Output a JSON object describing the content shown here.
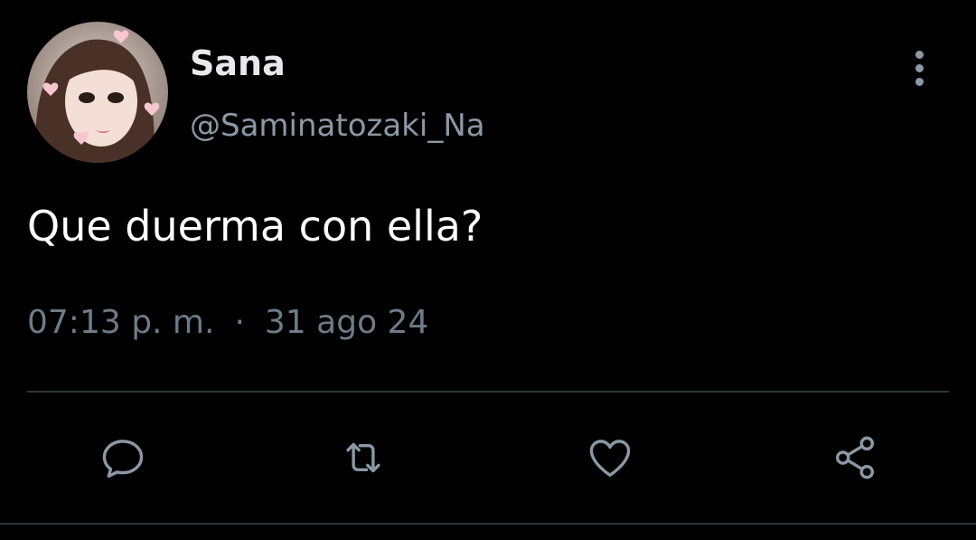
{
  "tweet": {
    "author": {
      "display_name": "Sana",
      "handle": "@Saminatozaki_Na"
    },
    "text": "Que duerma con ella?",
    "time": "07:13 p. m.",
    "separator": "·",
    "date": "31 ago 24"
  },
  "icons": {
    "more": "more-vertical-icon",
    "reply": "reply-icon",
    "retweet": "retweet-icon",
    "like": "heart-icon",
    "share": "share-icon"
  },
  "colors": {
    "background": "#000000",
    "text": "#ffffff",
    "secondary": "#8b98a5",
    "meta": "#6e7b88",
    "divider": "#2f3336"
  }
}
